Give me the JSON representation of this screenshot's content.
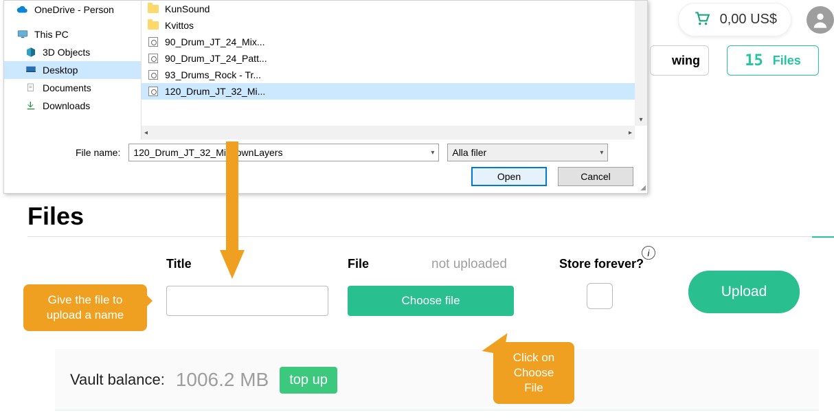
{
  "dialog": {
    "nav": {
      "onedrive": "OneDrive - Person",
      "thispc": "This PC",
      "objects3d": "3D Objects",
      "desktop": "Desktop",
      "documents": "Documents",
      "downloads": "Downloads"
    },
    "files": [
      {
        "name": "KunSound",
        "type": "folder"
      },
      {
        "name": "Kvittos",
        "type": "folder"
      },
      {
        "name": "90_Drum_JT_24_Mix...",
        "type": "audio"
      },
      {
        "name": "90_Drum_JT_24_Patt...",
        "type": "audio"
      },
      {
        "name": "93_Drums_Rock - Tr...",
        "type": "audio"
      },
      {
        "name": "120_Drum_JT_32_Mi...",
        "type": "audio",
        "selected": true
      }
    ],
    "filename_label": "File name:",
    "filename_value": "120_Drum_JT_32_MixdownLayers",
    "filter_value": "Alla filer",
    "open_btn": "Open",
    "cancel_btn": "Cancel"
  },
  "header": {
    "cart_amount": "0,00 US$",
    "stat_a": "wing",
    "stat_b_num": "15",
    "stat_b_lbl": "Files"
  },
  "page": {
    "heading": "Files",
    "title_lbl": "Title",
    "file_lbl": "File",
    "store_lbl": "Store forever?",
    "status": "not uploaded",
    "choose_btn": "Choose file",
    "upload_btn": "Upload",
    "vault_lbl": "Vault balance:",
    "vault_val": "1006.2 MB",
    "topup_btn": "top up"
  },
  "callouts": {
    "a": "Give the file to upload a name",
    "b": "Click on Choose File"
  },
  "colors": {
    "accent": "#29bf8f",
    "callout": "#f0a020"
  }
}
